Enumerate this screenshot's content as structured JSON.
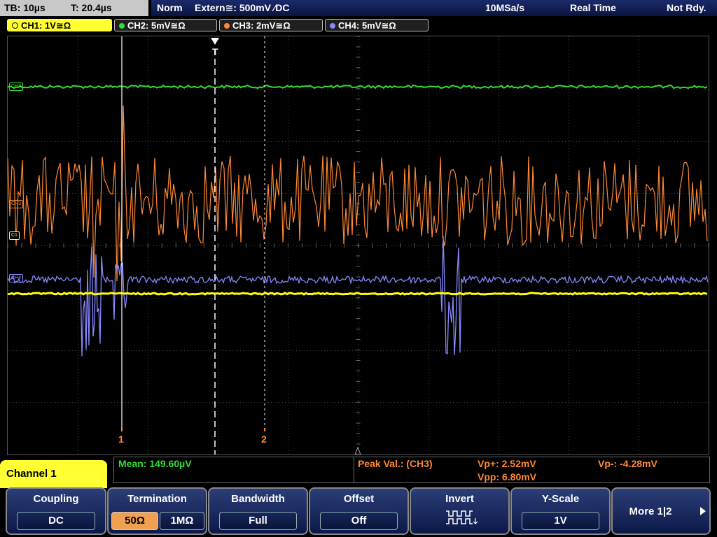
{
  "status": {
    "timebase": "TB: 10µs",
    "trigger_pos": "T: 20.4µs",
    "trigger_mode": "Norm",
    "trigger_source": "Extern≅: 500mV ⁄DC",
    "sample_rate": "10MSa/s",
    "acq_mode": "Real Time",
    "state": "Not Rdy."
  },
  "channels": [
    {
      "label": "CH1: 1V≅Ω",
      "color": "#ffff00"
    },
    {
      "label": "CH2: 5mV≅Ω",
      "color": "#33dd33"
    },
    {
      "label": "CH3: 2mV≅Ω",
      "color": "#ff8833"
    },
    {
      "label": "CH4: 5mV≅Ω",
      "color": "#8888ff"
    }
  ],
  "markers": {
    "ch_tags": [
      "CH2",
      "CH3",
      "C1",
      "CH4"
    ],
    "cursor1": "1",
    "cursor2": "2",
    "trigger_marker": "T"
  },
  "measurements": {
    "mean": "Mean: 149.60µV",
    "peak_label": "Peak Val.:  (CH3)",
    "vp_plus": "Vp+: 2.52mV",
    "vp_minus": "Vp-: -4.28mV",
    "vpp": "Vpp: 6.80mV"
  },
  "menu": {
    "title": "Channel 1",
    "coupling": {
      "title": "Coupling",
      "value": "DC"
    },
    "termination": {
      "title": "Termination",
      "opt1": "50Ω",
      "opt2": "1MΩ"
    },
    "bandwidth": {
      "title": "Bandwidth",
      "value": "Full"
    },
    "offset": {
      "title": "Offset",
      "value": "Off"
    },
    "invert": {
      "title": "Invert"
    },
    "yscale": {
      "title": "Y-Scale",
      "value": "1V"
    },
    "more": {
      "title": "More 1|2"
    }
  },
  "colors": {
    "ch1": "#ffff00",
    "ch2": "#33dd33",
    "ch3": "#ff8833",
    "ch4": "#8888ff",
    "grid": "#444444",
    "active_tab": "#ffff33"
  }
}
